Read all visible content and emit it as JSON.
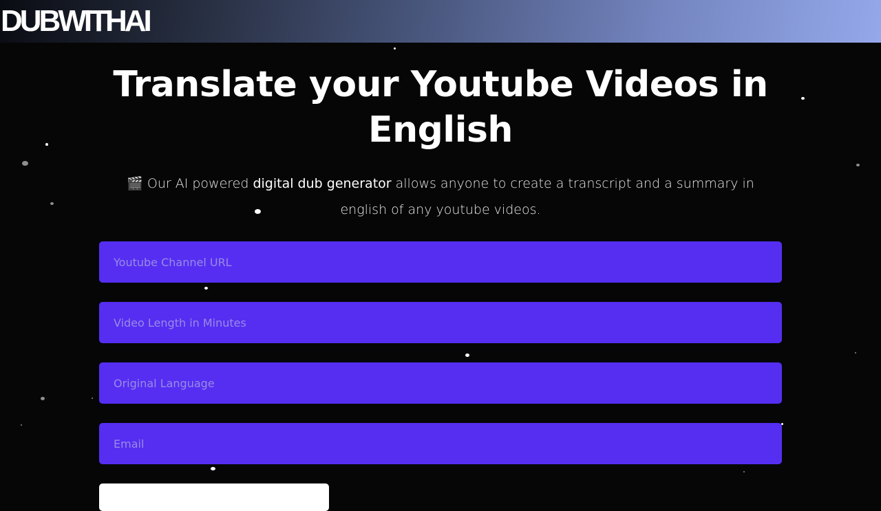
{
  "brand": {
    "logo_text": "DUBWITHAI"
  },
  "hero": {
    "title": "Translate your Youtube Videos in English",
    "emoji": "🎬",
    "desc_pre": " Our AI powered ",
    "desc_highlight": "digital dub generator",
    "desc_post": " allows anyone to create a transcript and a summary in english of any youtube videos."
  },
  "form": {
    "channel_url_placeholder": "Youtube Channel URL",
    "video_length_placeholder": "Video Length in Minutes",
    "original_language_placeholder": "Original Language",
    "email_placeholder": "Email"
  },
  "colors": {
    "background": "#060606",
    "input_bg": "#552ef2",
    "placeholder": "#9b8ae6",
    "header_gradient_end": "#94a8ea"
  }
}
